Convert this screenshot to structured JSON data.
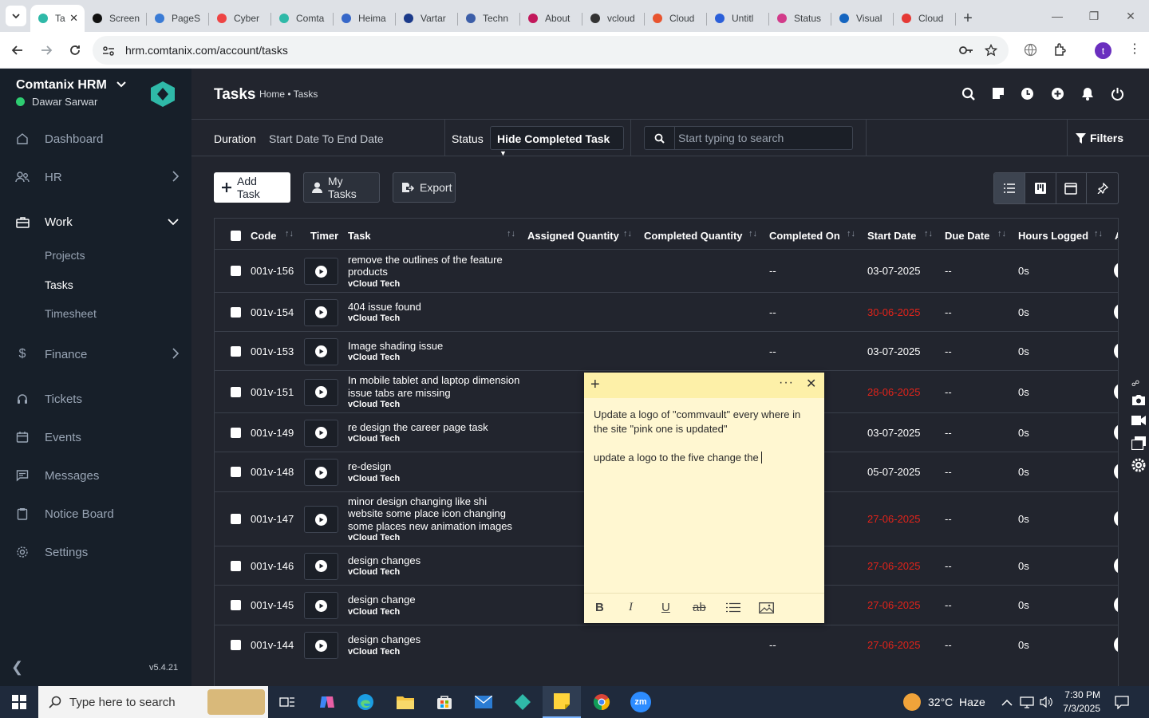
{
  "browser": {
    "tabs": [
      {
        "title": "Ta",
        "icon": "comtanix-icon",
        "active": true
      },
      {
        "title": "Screen",
        "icon": "screencast-icon"
      },
      {
        "title": "PageS",
        "icon": "pagespeed-icon"
      },
      {
        "title": "Cyber",
        "icon": "cyber-icon"
      },
      {
        "title": "Comta",
        "icon": "comtanix-icon"
      },
      {
        "title": "Heima",
        "icon": "scale-icon"
      },
      {
        "title": "Vartar",
        "icon": "x-icon"
      },
      {
        "title": "Techn",
        "icon": "check-icon"
      },
      {
        "title": "About",
        "icon": "about-icon"
      },
      {
        "title": "vcloud",
        "icon": "github-icon"
      },
      {
        "title": "Cloud",
        "icon": "cloud-icon"
      },
      {
        "title": "Untitl",
        "icon": "doc-icon"
      },
      {
        "title": "Status",
        "icon": "status-icon"
      },
      {
        "title": "Visual",
        "icon": "visual-icon"
      },
      {
        "title": "Cloud",
        "icon": "cloud-icon"
      }
    ],
    "url": "hrm.comtanix.com/account/tasks",
    "profile_initial": "t"
  },
  "sidebar": {
    "brand": "Comtanix HRM",
    "user": "Dawar Sarwar",
    "items": [
      {
        "label": "Dashboard",
        "icon": "home-icon"
      },
      {
        "label": "HR",
        "icon": "users-icon"
      },
      {
        "label": "Work",
        "icon": "briefcase-icon"
      },
      {
        "label": "Finance",
        "icon": "dollar-icon"
      },
      {
        "label": "Tickets",
        "icon": "headset-icon"
      },
      {
        "label": "Events",
        "icon": "calendar-icon"
      },
      {
        "label": "Messages",
        "icon": "message-icon"
      },
      {
        "label": "Notice Board",
        "icon": "clipboard-icon"
      },
      {
        "label": "Settings",
        "icon": "gear-icon"
      }
    ],
    "work_sub": [
      "Projects",
      "Tasks",
      "Timesheet"
    ],
    "version": "v5.4.21"
  },
  "header": {
    "title": "Tasks",
    "breadcrumb": "Home • Tasks"
  },
  "filterbar": {
    "duration_label": "Duration",
    "duration_value": "Start Date To End Date",
    "status_label": "Status",
    "status_value": "Hide Completed Task",
    "search_placeholder": "Start typing to search",
    "filters_label": "Filters"
  },
  "toolbar": {
    "add_task": "Add Task",
    "my_tasks": "My Tasks",
    "export": "Export"
  },
  "table": {
    "columns": [
      "Code",
      "Timer",
      "Task",
      "Assigned Quantity",
      "Completed Quantity",
      "Completed On",
      "Start Date",
      "Due Date",
      "Hours Logged",
      "A"
    ],
    "rows": [
      {
        "code": "001v-156",
        "task": "remove the outlines of the feature products",
        "client": "vCloud Tech",
        "completed_on": "--",
        "start": "03-07-2025",
        "start_overdue": false,
        "due": "--",
        "hours": "0s"
      },
      {
        "code": "001v-154",
        "task": "404 issue found",
        "client": "vCloud Tech",
        "completed_on": "--",
        "start": "30-06-2025",
        "start_overdue": true,
        "due": "--",
        "hours": "0s"
      },
      {
        "code": "001v-153",
        "task": "Image shading issue",
        "client": "vCloud Tech",
        "completed_on": "--",
        "start": "03-07-2025",
        "start_overdue": false,
        "due": "--",
        "hours": "0s"
      },
      {
        "code": "001v-151",
        "task": "In mobile tablet and laptop dimension issue tabs are missing",
        "client": "vCloud Tech",
        "completed_on": "",
        "start": "28-06-2025",
        "start_overdue": true,
        "due": "--",
        "hours": "0s"
      },
      {
        "code": "001v-149",
        "task": "re design the career page task",
        "client": "vCloud Tech",
        "completed_on": "",
        "start": "03-07-2025",
        "start_overdue": false,
        "due": "--",
        "hours": "0s"
      },
      {
        "code": "001v-148",
        "task": "re-design",
        "client": "vCloud Tech",
        "completed_on": "",
        "start": "05-07-2025",
        "start_overdue": false,
        "due": "--",
        "hours": "0s"
      },
      {
        "code": "001v-147",
        "task": "minor design changing like shi website some place icon changing some places new animation images",
        "client": "vCloud Tech",
        "completed_on": "",
        "start": "27-06-2025",
        "start_overdue": true,
        "due": "--",
        "hours": "0s"
      },
      {
        "code": "001v-146",
        "task": "design changes",
        "client": "vCloud Tech",
        "completed_on": "",
        "start": "27-06-2025",
        "start_overdue": true,
        "due": "--",
        "hours": "0s"
      },
      {
        "code": "001v-145",
        "task": "design change",
        "client": "vCloud Tech",
        "completed_on": "",
        "start": "27-06-2025",
        "start_overdue": true,
        "due": "--",
        "hours": "0s"
      },
      {
        "code": "001v-144",
        "task": "design changes",
        "client": "vCloud Tech",
        "completed_on": "--",
        "start": "27-06-2025",
        "start_overdue": true,
        "due": "--",
        "hours": "0s"
      }
    ]
  },
  "sticky_note": {
    "line1": "Update a logo of \"commvault\" every where in the site \"pink one is updated\"",
    "line2": "update a logo to the five change the"
  },
  "taskbar": {
    "search_placeholder": "Type here to search",
    "weather": "32°C  Haze",
    "time": "7:30 PM",
    "date": "7/3/2025"
  },
  "colors": {
    "sidebar_bg": "#171f29",
    "main_bg": "#22252e",
    "overdue": "#e2231a",
    "online": "#2ecc71",
    "note_bg": "#fff7d1"
  }
}
